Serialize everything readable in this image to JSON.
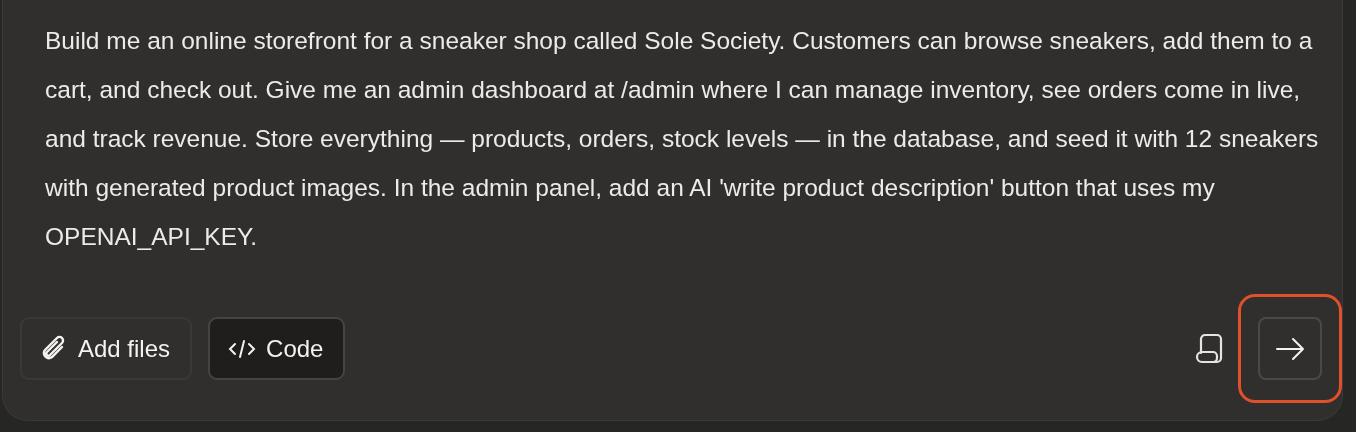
{
  "prompt": {
    "value": "Build me an online storefront for a sneaker shop called Sole Society. Customers can browse sneakers, add them to a cart, and check out. Give me an admin dashboard at /admin where I can manage inventory, see orders come in live, and track revenue. Store everything — products, orders, stock levels — in the database, and seed it with 12 sneakers with generated product images. In the admin panel, add an AI 'write product description' button that uses my OPENAI_API_KEY."
  },
  "toolbar": [
    {
      "label": "Add files",
      "kind": "attach",
      "selected": false
    },
    {
      "label": "Code",
      "kind": "code",
      "selected": true
    }
  ],
  "send_button": {
    "highlighted": true
  }
}
